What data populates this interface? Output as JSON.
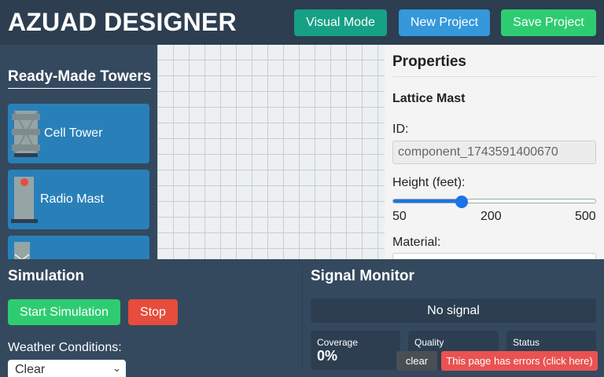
{
  "header": {
    "title": "AZUAD DESIGNER",
    "visual_mode_label": "Visual Mode",
    "new_project_label": "New Project",
    "save_project_label": "Save Project",
    "colors": {
      "visual": "#16a085",
      "new": "#3498db",
      "save": "#2ecc71"
    }
  },
  "sidebar": {
    "title": "Ready-Made Towers",
    "towers": [
      {
        "label": "Cell Tower",
        "icon": "cell-tower-icon"
      },
      {
        "label": "Radio Mast",
        "icon": "radio-mast-icon"
      },
      {
        "label": "",
        "icon": "tower-icon"
      }
    ]
  },
  "properties": {
    "title": "Properties",
    "component_name": "Lattice Mast",
    "id_label": "ID:",
    "id_value": "component_1743591400670",
    "height_label": "Height (feet):",
    "height_min": "50",
    "height_value": "200",
    "height_max": "500",
    "height_fraction": 0.34,
    "material_label": "Material:"
  },
  "simulation": {
    "title": "Simulation",
    "start_label": "Start Simulation",
    "stop_label": "Stop",
    "weather_label": "Weather Conditions:",
    "weather_value": "Clear"
  },
  "signal": {
    "title": "Signal Monitor",
    "status_text": "No signal",
    "coverage_label": "Coverage",
    "coverage_value": "0%",
    "quality_label": "Quality",
    "status_label": "Status"
  },
  "overlay": {
    "clear_label": " clear",
    "error_label": "This page has errors (click here)"
  }
}
